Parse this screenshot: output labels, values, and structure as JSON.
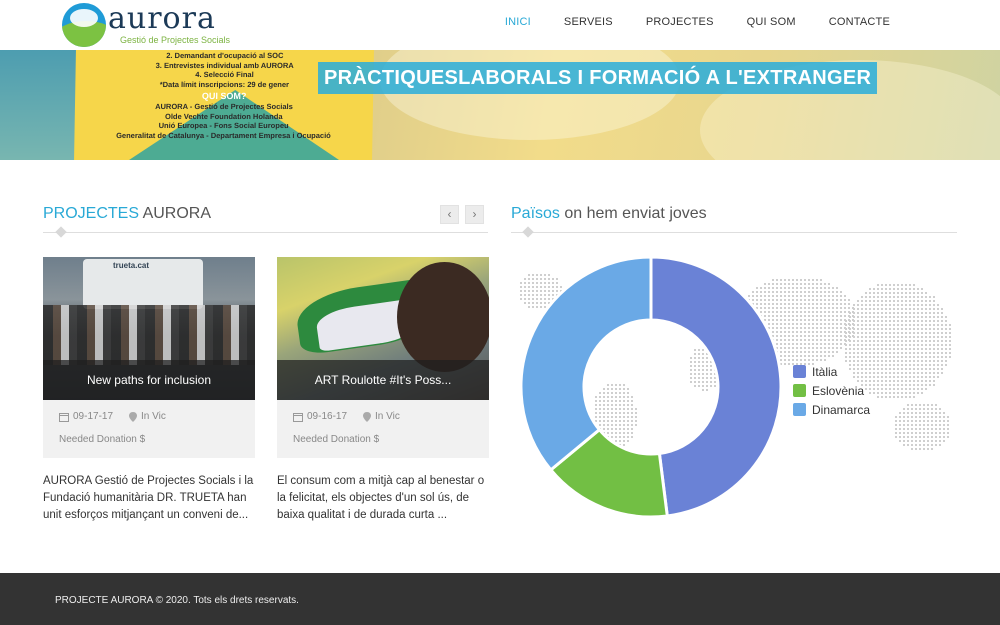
{
  "header": {
    "logo_word": "aurora",
    "logo_sub": "Gestió de Projectes Socials",
    "nav": [
      {
        "label": "INICI",
        "active": true
      },
      {
        "label": "SERVEIS",
        "active": false
      },
      {
        "label": "PROJECTES",
        "active": false
      },
      {
        "label": "QUI SOM",
        "active": false
      },
      {
        "label": "CONTACTE",
        "active": false
      }
    ]
  },
  "hero": {
    "title": "PRÀCTIQUESLABORALS I FORMACIÓ A L'EXTRANGER",
    "poster_lines": [
      "2. Demandant d'ocupació al SOC",
      "3. Entrevistes individual amb AURORA",
      "4. Selecció Final",
      "*Data límit inscripcions: 29 de gener",
      "QUI SOM?",
      "AURORA - Gestió de Projectes Socials",
      "Olde Vechte Foundation Holanda",
      "Unió Europea - Fons Social Europeu",
      "Generalitat de Catalunya - Departament Empresa i Ocupació"
    ]
  },
  "projects": {
    "title_accent": "PROJECTES",
    "title_rest": " AURORA",
    "prev_label": "‹",
    "next_label": "›",
    "cards": [
      {
        "caption": "New paths for inclusion",
        "date": "09-17-17",
        "location": "In Vic",
        "donation": "Needed Donation $",
        "description": "AURORA Gestió de Projectes Socials i la Fundació humanitària DR. TRUETA han unit esforços mitjançant un conveni de...",
        "photo_text": "trueta.cat"
      },
      {
        "caption": "ART Roulotte #It's Poss...",
        "date": "09-16-17",
        "location": "In Vic",
        "donation": "Needed Donation $",
        "description": "El consum com a mitjà cap al benestar o la felicitat, els objectes d'un sol ús, de baixa qualitat i de durada curta ..."
      }
    ]
  },
  "countries": {
    "title_accent": "Països",
    "title_rest": " on hem enviat joves"
  },
  "chart_data": {
    "type": "pie",
    "donut": true,
    "categories": [
      "Itàlia",
      "Eslovènia",
      "Dinamarca"
    ],
    "values": [
      48,
      16,
      36
    ],
    "colors": [
      "#6a82d6",
      "#72bf44",
      "#6aa9e6"
    ],
    "legend": "right"
  },
  "footer": {
    "text": "PROJECTE AURORA © 2020. Tots els drets reservats."
  }
}
